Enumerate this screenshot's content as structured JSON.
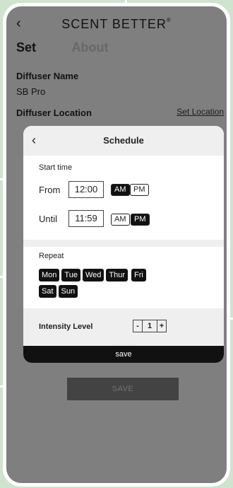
{
  "header": {
    "brand": "SCENT BETTER",
    "brand_mark": "®"
  },
  "tabs": {
    "set": "Set",
    "about": "About"
  },
  "diffuser": {
    "name_label": "Diffuser Name",
    "name_value": "SB Pro",
    "location_label": "Diffuser Location",
    "set_location_link": "Set Location"
  },
  "save_button": "SAVE",
  "schedule": {
    "title": "Schedule",
    "start_time_label": "Start time",
    "from_label": "From",
    "from_value": "12:00",
    "from_am": "AM",
    "from_pm": "PM",
    "until_label": "Until",
    "until_value": "11:59",
    "until_am": "AM",
    "until_pm": "PM",
    "repeat_label": "Repeat",
    "days": [
      "Mon",
      "Tue",
      "Wed",
      "Thur",
      "Fri",
      "Sat",
      "Sun"
    ],
    "intensity_label": "Intensity Level",
    "intensity_minus": "-",
    "intensity_value": "1",
    "intensity_plus": "+",
    "save_label": "save"
  },
  "icons": {
    "back": "chevron-left-icon"
  }
}
